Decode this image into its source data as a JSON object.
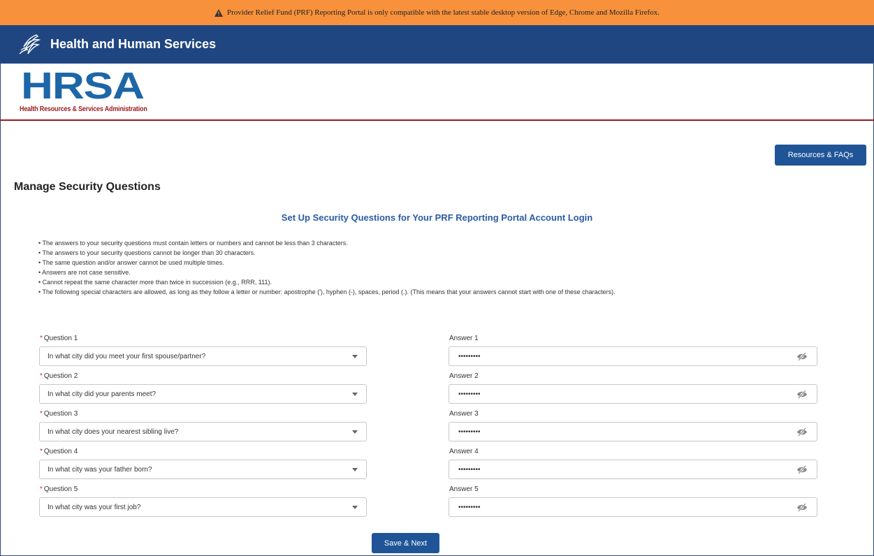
{
  "banner": {
    "warning_text": "Provider Relief Fund (PRF) Reporting Portal is only compatible with the latest stable desktop version of Edge, Chrome and Mozilla Firefox."
  },
  "header": {
    "title": "Health and Human Services"
  },
  "logo": {
    "word": "HRSA",
    "subtitle": "Health Resources & Services Administration"
  },
  "toolbar": {
    "resources_label": "Resources & FAQs"
  },
  "page": {
    "title": "Manage Security Questions",
    "section_title": "Set Up Security Questions for Your PRF Reporting Portal Account Login"
  },
  "rules": [
    "• The answers to your security questions must contain letters or numbers and cannot be less than 3 characters.",
    "• The answers to your security questions cannot be longer than 30 characters.",
    "• The same question and/or answer cannot be used multiple times.",
    "• Answers are not case sensitive.",
    "• Cannot repeat the same character more than twice in succession (e.g., RRR, 111).",
    "• The following special characters are allowed, as long as they follow a letter or number: apostrophe ('), hyphen (-), spaces, period (.). (This means that your answers cannot start with one of these characters)."
  ],
  "questions": [
    {
      "label": "Question 1",
      "value": "In what city did you meet your first spouse/partner?",
      "answer_label": "Answer 1",
      "answer_value": "•••••••••"
    },
    {
      "label": "Question 2",
      "value": "In what city did your parents meet?",
      "answer_label": "Answer 2",
      "answer_value": "•••••••••"
    },
    {
      "label": "Question 3",
      "value": "In what city does your nearest sibling live?",
      "answer_label": "Answer 3",
      "answer_value": "•••••••••"
    },
    {
      "label": "Question 4",
      "value": "In what city was your father born?",
      "answer_label": "Answer 4",
      "answer_value": "•••••••••"
    },
    {
      "label": "Question 5",
      "value": "In what city was your first job?",
      "answer_label": "Answer 5",
      "answer_value": "•••••••••"
    }
  ],
  "required_marker": "*",
  "actions": {
    "save_label": "Save & Next"
  },
  "colors": {
    "warning_bg": "#f7913c",
    "header_bg": "#1f4680",
    "brand_blue": "#1d66a7",
    "brand_red": "#9b1c20",
    "button_bg": "#1f5597"
  },
  "icons": {
    "warning": "warning-triangle-icon",
    "logo": "hhs-eagle-icon",
    "visibility": "eye-slash-icon",
    "dropdown": "chevron-down-icon"
  }
}
